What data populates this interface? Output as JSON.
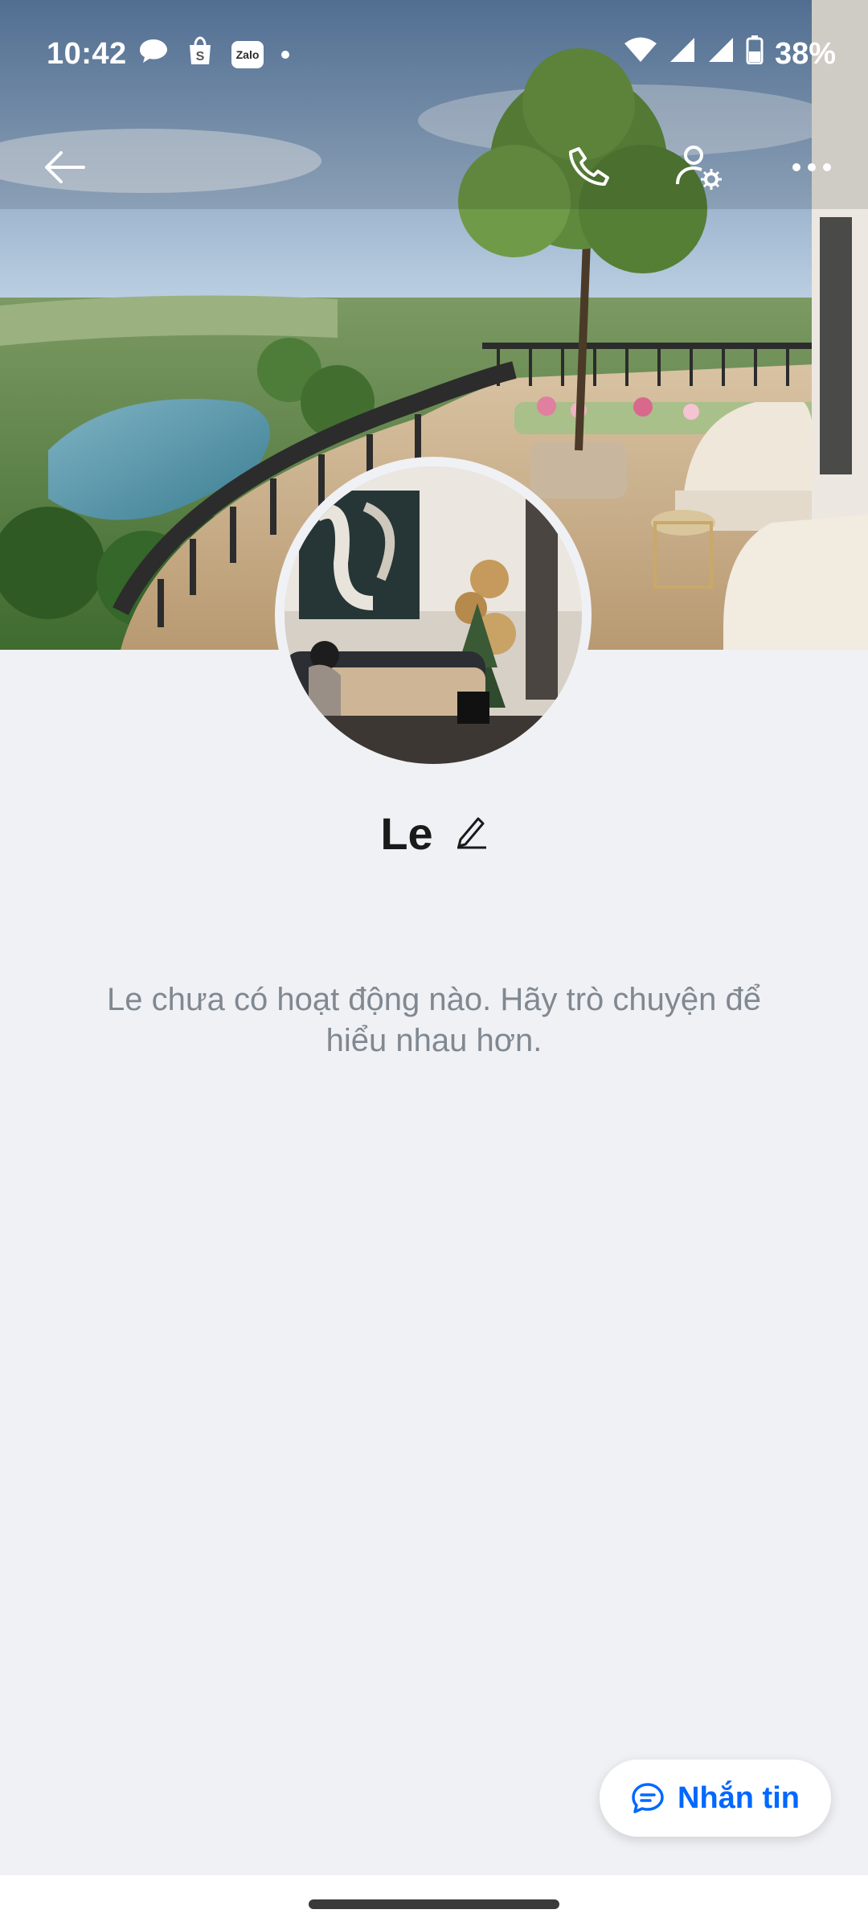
{
  "status": {
    "time": "10:42",
    "battery": "38%",
    "zalo_badge": "Zalo",
    "left_icons": [
      "chat-bubble-icon",
      "shopee-bag-icon",
      "zalo-icon",
      "notification-dot-icon"
    ],
    "right_icons": [
      "wifi-icon",
      "signal-icon",
      "signal-icon",
      "battery-icon"
    ]
  },
  "header": {
    "icons": [
      "back-arrow-icon",
      "phone-icon",
      "user-settings-icon",
      "more-icon"
    ]
  },
  "profile": {
    "name": "Le",
    "edit_icon": "pencil-icon",
    "empty_message": "Le chưa có hoạt động nào. Hãy trò chuyện để hiểu nhau hơn."
  },
  "action": {
    "message_label": "Nhắn tin",
    "message_icon": "chat-icon",
    "accent": "#0068ff"
  },
  "colors": {
    "background": "#f0f1f5",
    "name_text": "#1a1a1a",
    "muted_text": "#808891"
  }
}
